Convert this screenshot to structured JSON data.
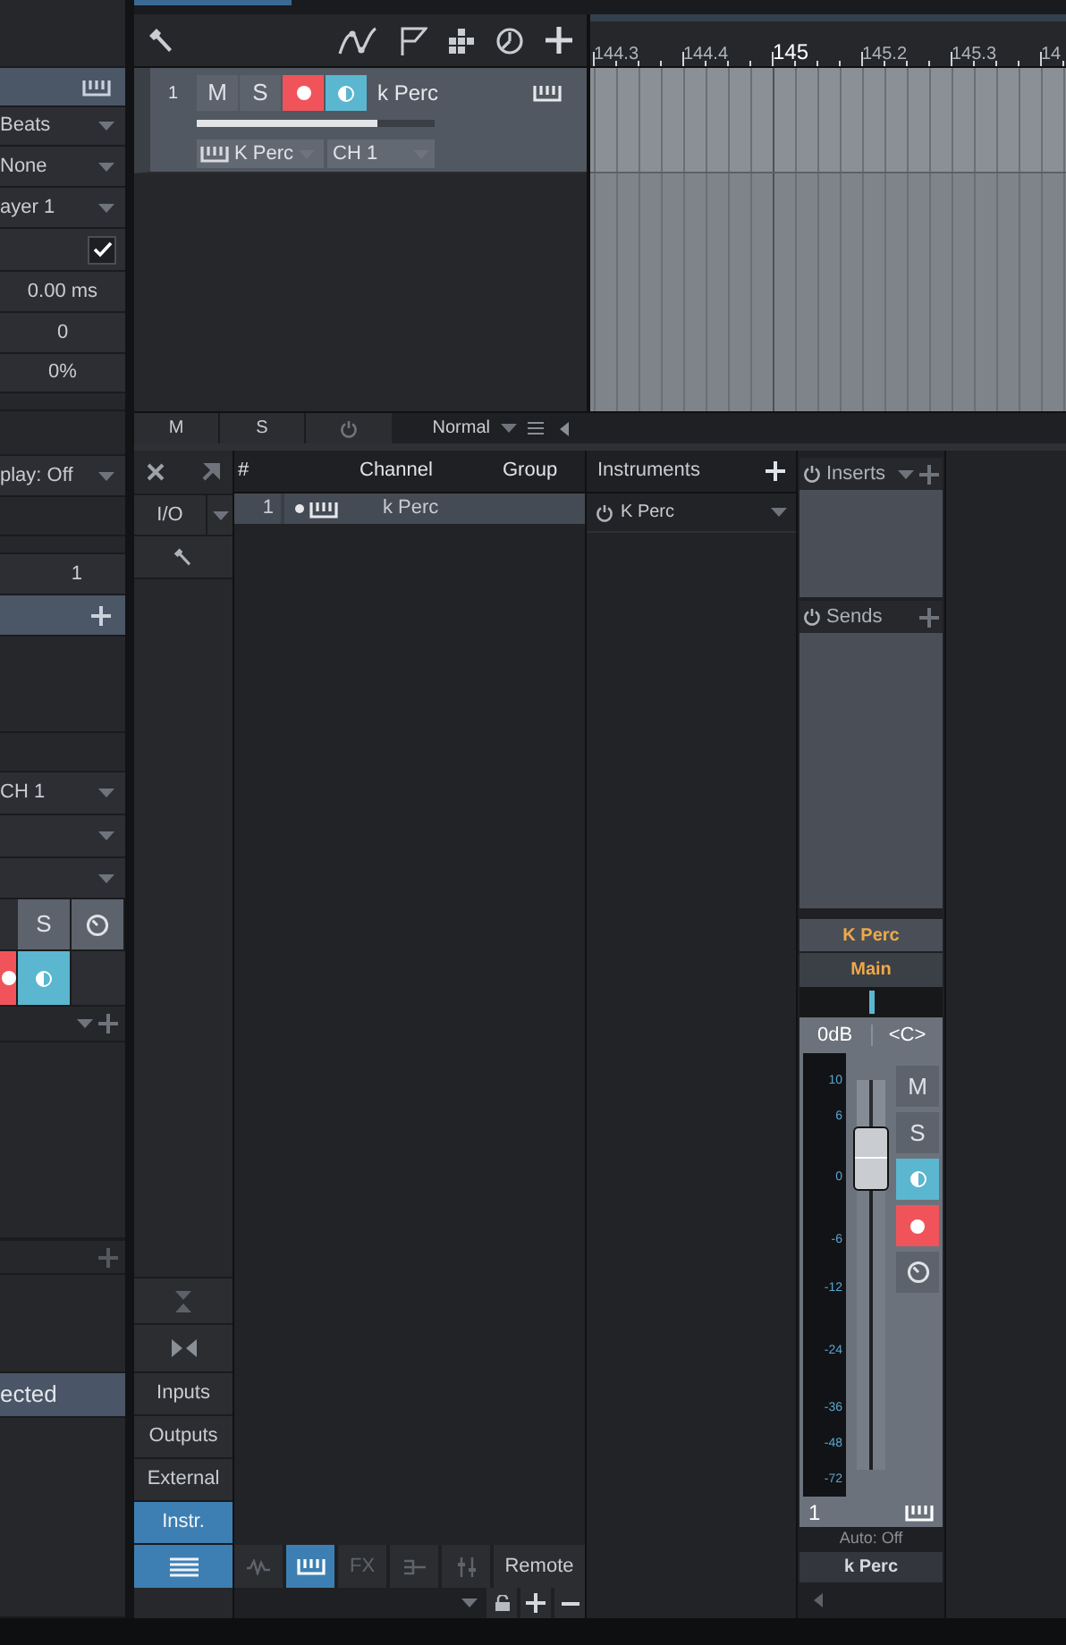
{
  "inspector": {
    "rows": [
      {
        "kind": "blank"
      },
      {
        "kind": "header"
      },
      {
        "kind": "dropdown",
        "value": "Beats"
      },
      {
        "kind": "dropdown",
        "value": "None"
      },
      {
        "kind": "dropdown",
        "value": "ayer 1"
      },
      {
        "kind": "checkbox",
        "checked": true
      },
      {
        "kind": "value",
        "value": "0.00 ms"
      },
      {
        "kind": "value",
        "value": "0"
      },
      {
        "kind": "value",
        "value": "0%"
      },
      {
        "kind": "blank"
      },
      {
        "kind": "blank"
      },
      {
        "kind": "dropdown",
        "value": "play: Off"
      },
      {
        "kind": "blank"
      },
      {
        "kind": "blank"
      },
      {
        "kind": "number",
        "value": "1"
      },
      {
        "kind": "header_plus"
      },
      {
        "kind": "blank"
      },
      {
        "kind": "blank"
      },
      {
        "kind": "dropdown",
        "value": "CH 1"
      },
      {
        "kind": "dropdown"
      },
      {
        "kind": "dropdown"
      },
      {
        "kind": "buttons",
        "buttons": [
          {
            "kind": "solo",
            "label": "S",
            "on": false
          },
          {
            "kind": "clock"
          }
        ]
      },
      {
        "kind": "buttons",
        "buttons": [
          {
            "kind": "record",
            "on": true
          },
          {
            "kind": "monitor",
            "on": true
          }
        ]
      },
      {
        "kind": "section_bar"
      },
      {
        "kind": "blank"
      },
      {
        "kind": "plus_bar"
      },
      {
        "kind": "blank"
      },
      {
        "kind": "highlight",
        "value": "ected"
      },
      {
        "kind": "blank"
      }
    ]
  },
  "track": {
    "number": "1",
    "name": "k Perc",
    "buttons": [
      {
        "kind": "mute",
        "label": "M",
        "on": false
      },
      {
        "kind": "solo",
        "label": "S",
        "on": false
      },
      {
        "kind": "record",
        "on": true
      },
      {
        "kind": "monitor",
        "on": true
      }
    ],
    "volume": {
      "level": 0.76
    },
    "instrument": "K Perc",
    "channel": "CH 1"
  },
  "ruler": {
    "labels": [
      {
        "text": "144.3",
        "kind": "beat"
      },
      {
        "text": "144.4",
        "kind": "beat"
      },
      {
        "text": "145",
        "kind": "bar"
      },
      {
        "text": "145.2",
        "kind": "beat"
      },
      {
        "text": "145.3",
        "kind": "beat"
      },
      {
        "text": "14",
        "kind": "beat"
      }
    ]
  },
  "track_footer": {
    "mute": "M",
    "solo": "S",
    "mode": "Normal"
  },
  "mixer": {
    "io": "I/O",
    "nav_items": [
      {
        "kind": "text",
        "label": "Inputs",
        "selected": false
      },
      {
        "kind": "text",
        "label": "Outputs",
        "selected": false
      },
      {
        "kind": "text",
        "label": "External",
        "selected": false
      },
      {
        "kind": "text",
        "label": "Instr.",
        "selected": true
      },
      {
        "kind": "list",
        "selected": true
      }
    ],
    "channel_list": {
      "columns": [
        "#",
        "Channel",
        "Group"
      ],
      "rows": [
        {
          "number": "1",
          "name": "k Perc",
          "selected": true
        }
      ]
    },
    "list_toolbar": [
      {
        "kind": "wave",
        "selected": false
      },
      {
        "kind": "piano",
        "selected": true
      },
      {
        "kind": "fx",
        "label": "FX",
        "selected": false
      },
      {
        "kind": "sends",
        "selected": false
      },
      {
        "kind": "faders",
        "selected": false
      },
      {
        "kind": "remote",
        "label": "Remote",
        "selected": false
      }
    ],
    "instruments": {
      "title": "Instruments",
      "items": [
        {
          "name": "K Perc"
        }
      ]
    },
    "strip": {
      "inserts": "Inserts",
      "sends": "Sends",
      "name": "K Perc",
      "output": "Main",
      "volume": "0dB",
      "pan": "<C>",
      "meter_scale": [
        "10",
        "6",
        "0",
        "-6",
        "-12",
        "-24",
        "-36",
        "-48",
        "-72"
      ],
      "pan_slider": {
        "level": 0.5
      },
      "fader": {
        "level": 0.8
      },
      "buttons": [
        {
          "kind": "mute",
          "label": "M",
          "on": false
        },
        {
          "kind": "solo",
          "label": "S",
          "on": false
        },
        {
          "kind": "monitor",
          "on": true
        },
        {
          "kind": "record",
          "on": true
        },
        {
          "kind": "clock"
        }
      ],
      "number": "1",
      "automation": "Auto: Off",
      "label": "k Perc"
    }
  }
}
